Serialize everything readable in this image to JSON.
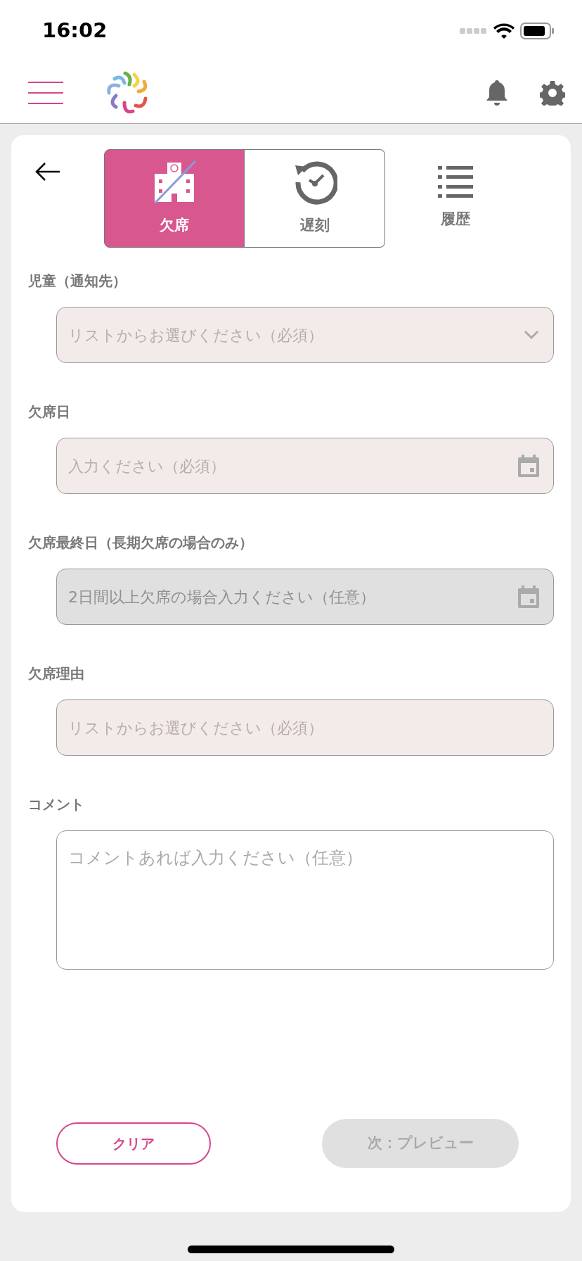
{
  "status_bar": {
    "time": "16:02"
  },
  "tabs": [
    {
      "label": "欠席",
      "kind": "absent",
      "selected": true
    },
    {
      "label": "遅刻",
      "kind": "late",
      "selected": false
    },
    {
      "label": "履歴",
      "kind": "history",
      "selected": false
    }
  ],
  "fields": [
    {
      "label": "児童（通知先）",
      "kind": "select",
      "placeholder": "リストからお選びください（必須）",
      "disabled": false
    },
    {
      "label": "欠席日",
      "kind": "date",
      "placeholder": "入力ください（必須）",
      "disabled": false
    },
    {
      "label": "欠席最終日（長期欠席の場合のみ）",
      "kind": "date",
      "placeholder": "2日間以上欠席の場合入力ください（任意）",
      "disabled": true
    },
    {
      "label": "欠席理由",
      "kind": "plain",
      "placeholder": "リストからお選びください（必須）",
      "disabled": false
    },
    {
      "label": "コメント",
      "kind": "textarea",
      "placeholder": "コメントあれば入力ください（任意）",
      "disabled": false
    }
  ],
  "buttons": {
    "clear": {
      "label": "クリア",
      "disabled": false
    },
    "next": {
      "label": "次：プレビュー",
      "disabled": true
    }
  }
}
